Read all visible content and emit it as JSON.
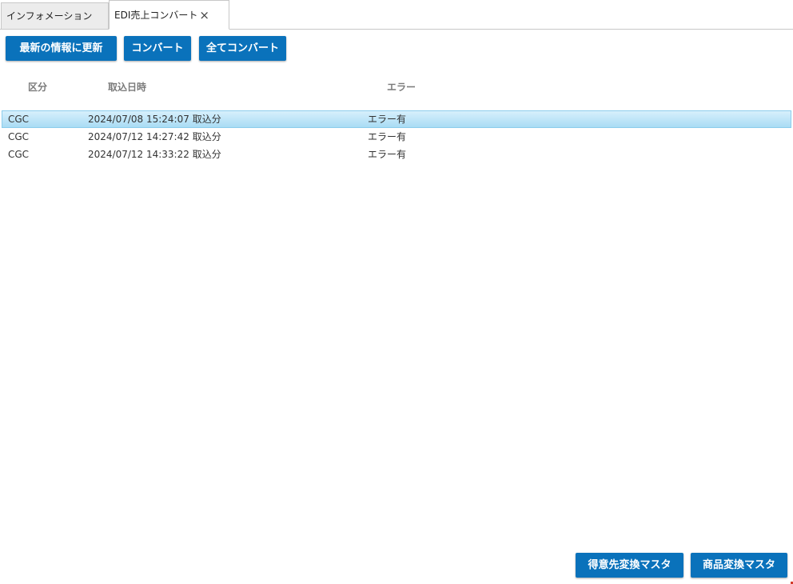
{
  "tabs": [
    {
      "label": "インフォメーション",
      "active": false
    },
    {
      "label": "EDI売上コンバート",
      "active": true,
      "close": "×"
    }
  ],
  "toolbar": {
    "refresh_label": "最新の情報に更新",
    "convert_label": "コンバート",
    "convert_all_label": "全てコンバート"
  },
  "grid": {
    "columns": {
      "kubun": "区分",
      "date": "取込日時",
      "error": "エラー"
    },
    "rows": [
      {
        "kubun": "CGC",
        "date": "2024/07/08 15:24:07 取込分",
        "error": "エラー有",
        "selected": true
      },
      {
        "kubun": "CGC",
        "date": "2024/07/12 14:27:42 取込分",
        "error": "エラー有",
        "selected": false
      },
      {
        "kubun": "CGC",
        "date": "2024/07/12 14:33:22 取込分",
        "error": "エラー有",
        "selected": false
      }
    ]
  },
  "footer": {
    "customer_master_label": "得意先変換マスタ",
    "product_master_label": "商品変換マスタ"
  },
  "colors": {
    "button_bg": "#0a72bb",
    "button_text": "#ffffff",
    "selection_top": "#d7f0fc",
    "selection_bottom": "#a9dcf4",
    "selection_border": "#8ccdec"
  }
}
